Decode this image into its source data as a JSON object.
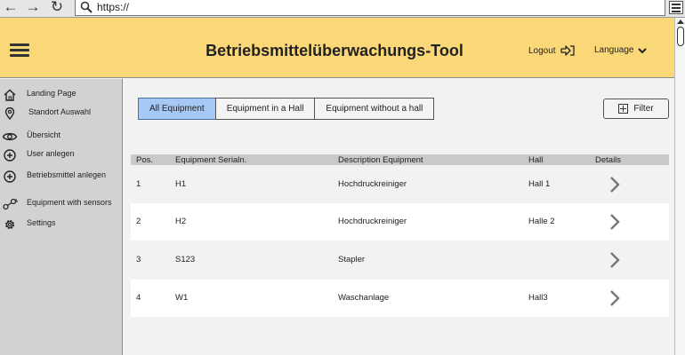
{
  "browser": {
    "url": "https://"
  },
  "header": {
    "title": "Betriebsmittelüberwachungs-Tool",
    "logout_label": "Logout",
    "language_label": "Language"
  },
  "sidebar": {
    "items": [
      {
        "label": "Landing Page",
        "icon": "home-icon"
      },
      {
        "label": "Standort Auswahl",
        "icon": "location-pin-icon"
      },
      {
        "label": "Übersicht",
        "icon": "eye-icon"
      },
      {
        "label": "User anlegen",
        "icon": "plus-circle-icon"
      },
      {
        "label": "Betriebsmittel anlegen",
        "icon": "plus-circle-icon"
      },
      {
        "label": "Equipment with sensors",
        "icon": "sensor-icon"
      },
      {
        "label": "Settings",
        "icon": "gear-icon"
      }
    ]
  },
  "filters": {
    "tabs": [
      "All Equipment",
      "Equipment in a Hall",
      "Equipment without a hall"
    ],
    "active_tab": "All Equipment",
    "filter_label": "Filter"
  },
  "table": {
    "headers": [
      "Pos.",
      "Equipment Serialn.",
      "Description Equipment",
      "Hall",
      "Details"
    ],
    "rows": [
      {
        "pos": "1",
        "serial": "H1",
        "description": "Hochdruckreiniger",
        "hall": "Hall 1"
      },
      {
        "pos": "2",
        "serial": "H2",
        "description": "Hochdruckreiniger",
        "hall": "Halle 2"
      },
      {
        "pos": "3",
        "serial": "S123",
        "description": "Stapler",
        "hall": ""
      },
      {
        "pos": "4",
        "serial": "W1",
        "description": "Waschanlage",
        "hall": "Hall3"
      }
    ]
  },
  "colors": {
    "header_bg": "#fad878",
    "active_tab": "#a6c8f5",
    "sidebar_bg": "#d2d2d2"
  }
}
